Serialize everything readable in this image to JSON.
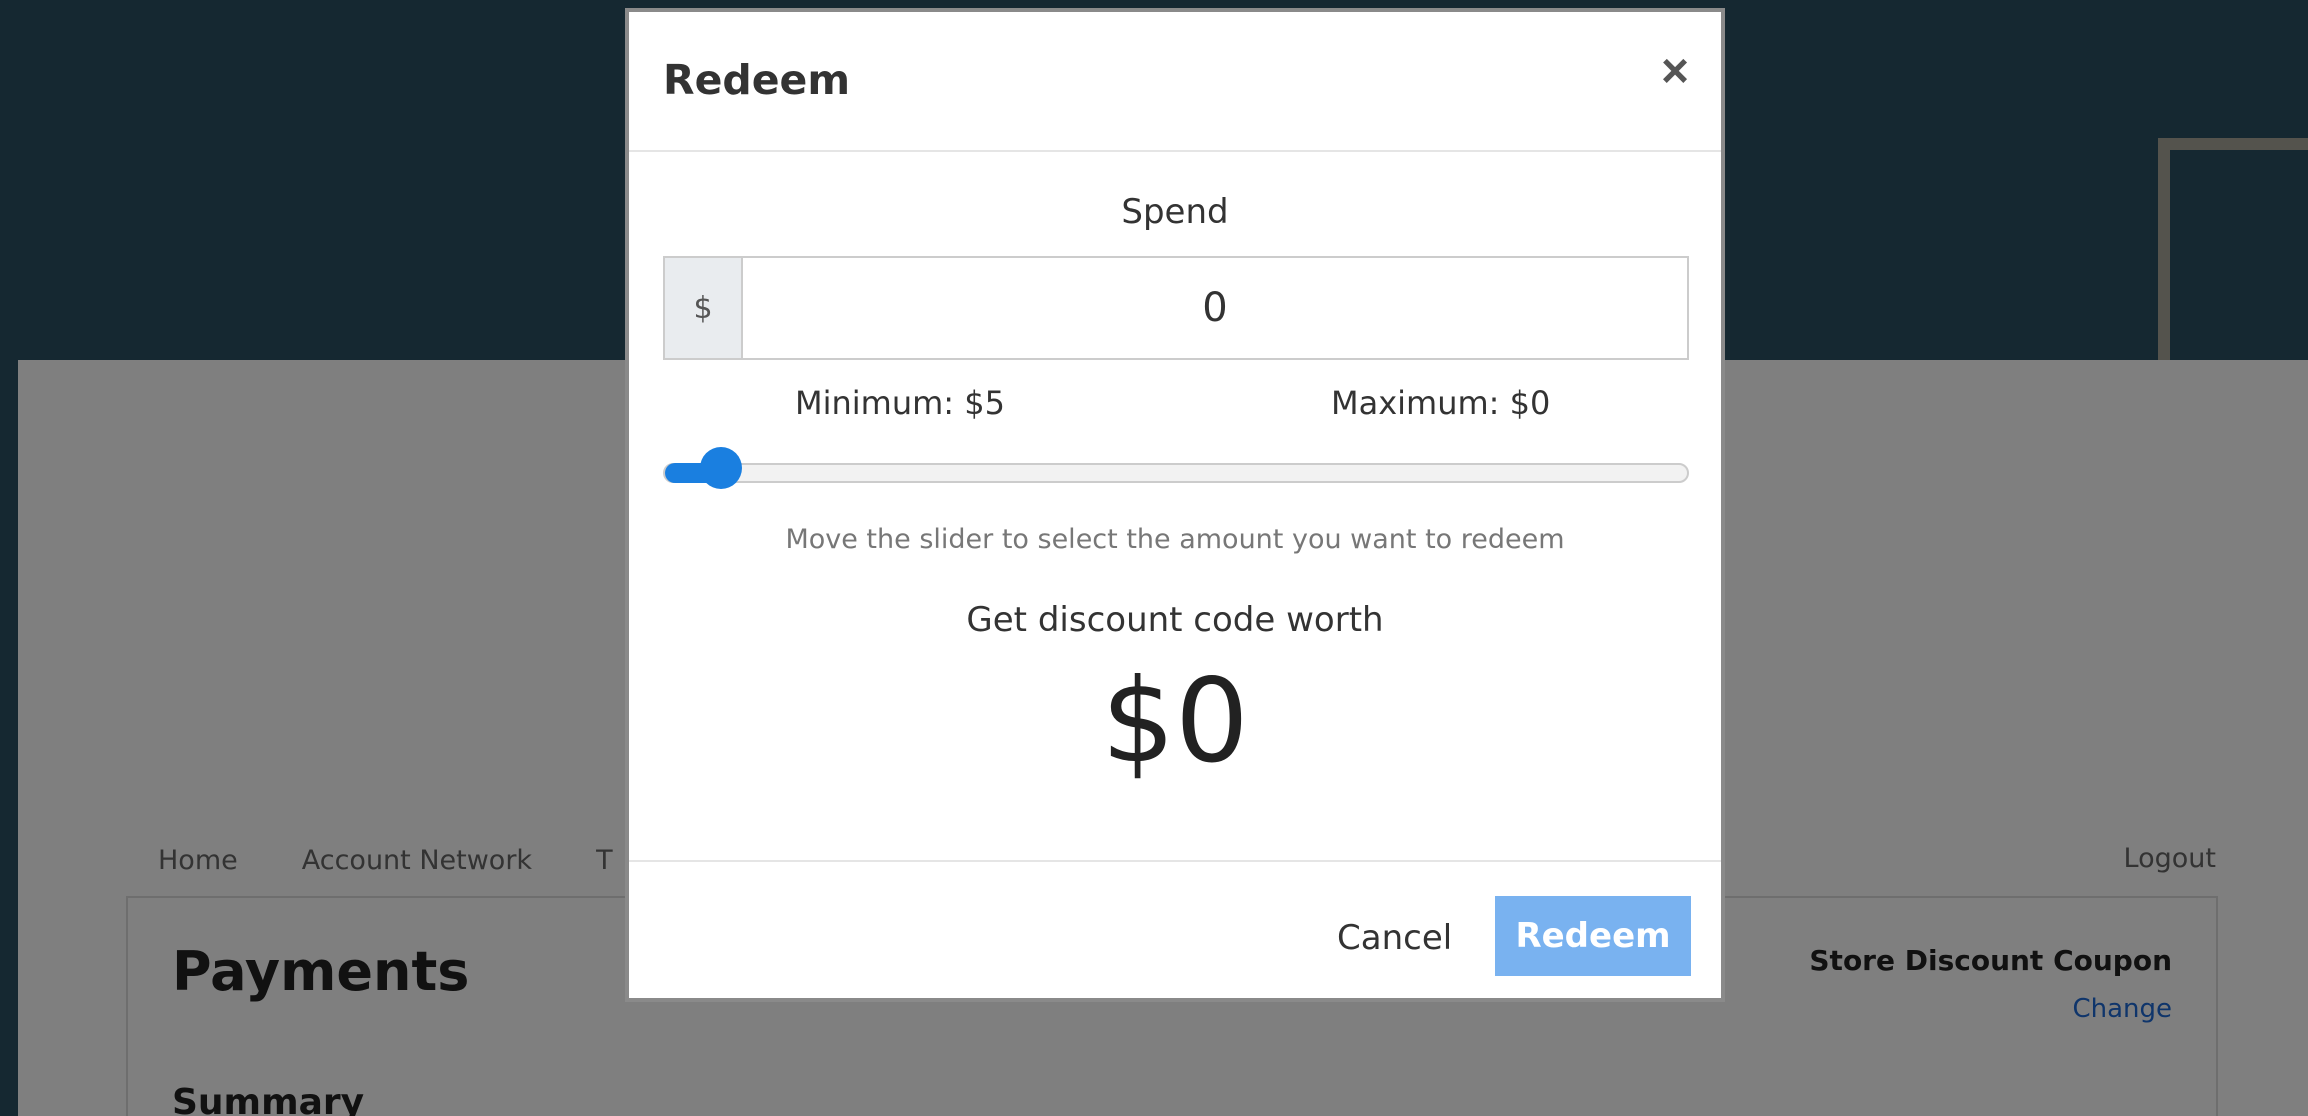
{
  "background": {
    "nav_items": [
      "Home",
      "Account Network",
      "T"
    ],
    "logout": "Logout",
    "page_title": "Payments",
    "summary_heading": "Summary",
    "coupon": {
      "title": "Store Discount Coupon",
      "change": "Change"
    }
  },
  "modal": {
    "title": "Redeem",
    "close_symbol": "×",
    "spend_label": "Spend",
    "currency_symbol": "$",
    "spend_value": "0",
    "minimum_label": "Minimum: $5",
    "maximum_label": "Maximum: $0",
    "slider_fraction": 0.045,
    "hint": "Move the slider to select the amount you want to redeem",
    "discount_label": "Get discount code worth",
    "discount_value": "$0",
    "cancel_label": "Cancel",
    "redeem_label": "Redeem"
  },
  "colors": {
    "backdrop": "#2b5163",
    "slider_accent": "#1a7fe0",
    "redeem_disabled": "#79b2f0"
  }
}
